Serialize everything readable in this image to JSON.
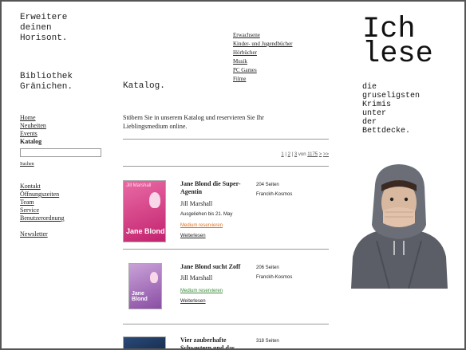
{
  "header": {
    "slogan": "Erweitere\ndeinen\nHorisont.",
    "library_name": "Bibliothek\nGränichen."
  },
  "top_nav": [
    {
      "label": "Erwachsene"
    },
    {
      "label": "Kinder- und Jugendbücher"
    },
    {
      "label": "Hörbücher"
    },
    {
      "label": "Musik"
    },
    {
      "label": "PC Games"
    },
    {
      "label": "Filme"
    }
  ],
  "left_nav": {
    "items": [
      {
        "label": "Home"
      },
      {
        "label": "Neuheiten"
      },
      {
        "label": "Events"
      },
      {
        "label": "Katalog",
        "active": true
      }
    ],
    "search_value": "",
    "search_link": "Suchen",
    "items2": [
      {
        "label": "Kontakt"
      },
      {
        "label": "Öffnungszeiten"
      },
      {
        "label": "Team"
      },
      {
        "label": "Service"
      },
      {
        "label": "Benutzerordnung"
      }
    ],
    "newsletter": "Newsletter"
  },
  "main": {
    "title": "Katalog.",
    "intro": "Stöbern Sie in unserem Katalog und reservieren Sie Ihr Lieblingsmedium online.",
    "pagination": {
      "pages": [
        "1",
        "2",
        "3"
      ],
      "separator": "|",
      "of_text": "von",
      "total": "1175",
      "next": ">",
      "last": ">>"
    },
    "books": [
      {
        "title": "Jane Blond die Super-Agentin",
        "author": "Jill Marshall",
        "status": "Ausgeliehen bis 21. May",
        "reserve": "Medium reservieren",
        "more": "Weiterlesen",
        "pages": "204 Seiten",
        "publisher": "Franckh-Kosmos",
        "cover_label": "Jane Blond"
      },
      {
        "title": "Jane Blond sucht Zoff",
        "author": "Jill Marshall",
        "status": "",
        "reserve": "Medium reservieren",
        "more": "Weiterlesen",
        "pages": "206 Seiten",
        "publisher": "Franckh-Kosmos",
        "cover_label": "Jane Blond"
      },
      {
        "title": "Vier zauberhafte Schwestern und das",
        "author": "",
        "status": "",
        "reserve": "",
        "more": "",
        "pages": "318 Seiten",
        "publisher": "",
        "cover_label": ""
      }
    ]
  },
  "right": {
    "headline": "Ich\nlese",
    "subtext": "die\ngruseligsten\nKrimis\nunter\nder\nBettdecke."
  },
  "colors": {
    "reserve_orange": "#e07020",
    "reserve_green": "#3a8a3a",
    "cover_pink": "#d23c84",
    "cover_purple": "#9a5cb5"
  }
}
